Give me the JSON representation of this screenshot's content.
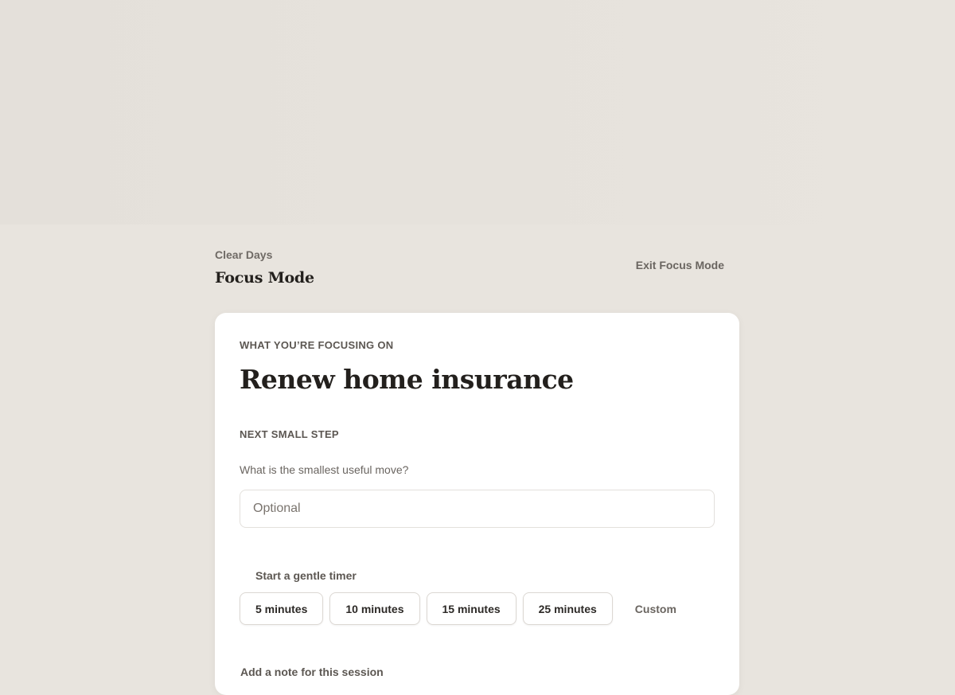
{
  "header": {
    "app_name": "Clear Days",
    "page_title": "Focus Mode",
    "exit_label": "Exit Focus Mode"
  },
  "focus": {
    "section_label": "WHAT YOU’RE FOCUSING ON",
    "task_title": "Renew home insurance"
  },
  "next_step": {
    "section_label": "NEXT SMALL STEP",
    "question": "What is the smallest useful move?",
    "placeholder": "Optional",
    "value": ""
  },
  "timer": {
    "label": "Start a gentle timer",
    "options": [
      "5 minutes",
      "10 minutes",
      "15 minutes",
      "25 minutes"
    ],
    "custom_label": "Custom"
  },
  "note": {
    "label": "Add a note for this session"
  },
  "colors": {
    "background": "#e8e4de",
    "card": "#ffffff",
    "text_primary": "#23201d",
    "text_muted": "#6a6560"
  }
}
